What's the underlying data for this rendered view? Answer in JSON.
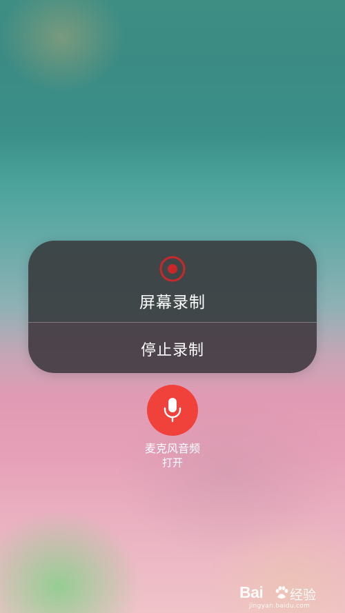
{
  "record_menu": {
    "title": "屏幕录制",
    "stop_action": "停止录制",
    "icon": "record-icon"
  },
  "microphone": {
    "label": "麦克风音频",
    "state": "打开",
    "icon": "microphone-icon",
    "color": "#f0413b"
  },
  "watermark": {
    "logo_text": "Bai",
    "cn_text": "经验",
    "url": "jingyan.baidu.com"
  }
}
